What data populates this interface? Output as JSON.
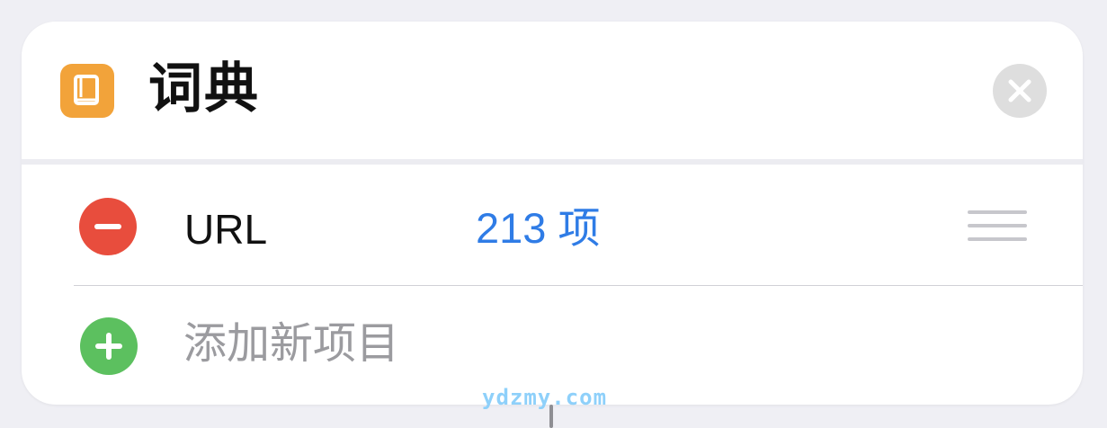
{
  "action_card": {
    "app_icon": "book-icon",
    "title": "词典",
    "close_icon": "close-icon",
    "accent_color": "#f2a33a"
  },
  "dictionary": {
    "items": [
      {
        "key": "URL",
        "value": "213 项",
        "remove_icon": "minus-icon",
        "reorder_icon": "drag-handle-icon"
      }
    ],
    "add_item_label": "添加新项目",
    "add_icon": "plus-icon"
  },
  "colors": {
    "remove": "#e84d3d",
    "add": "#5cc05f",
    "value_link": "#2f7ce6",
    "placeholder": "#9b9b9f"
  },
  "watermark": "ydzmy.com"
}
